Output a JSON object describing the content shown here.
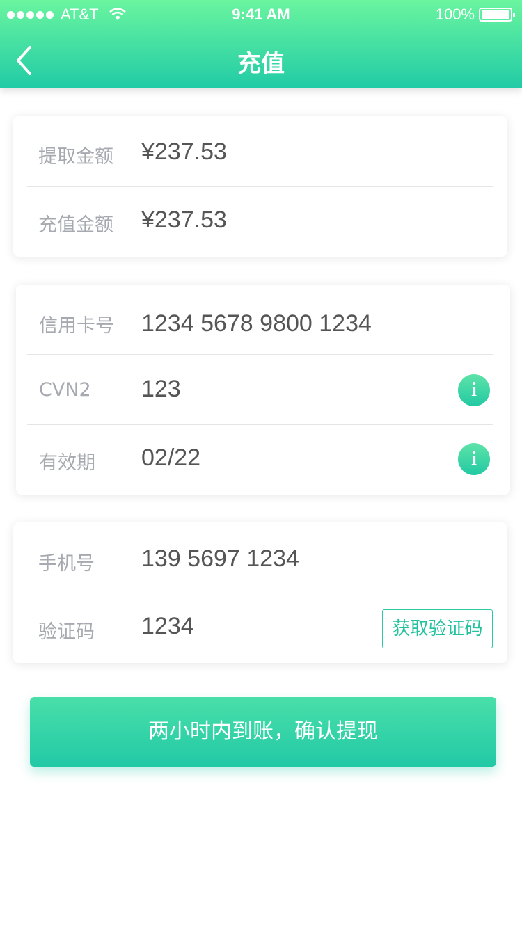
{
  "status_bar": {
    "carrier": "AT&T",
    "time": "9:41 AM",
    "battery": "100%"
  },
  "header": {
    "title": "充值",
    "back_icon": "chevron-left-icon"
  },
  "amount_card": {
    "rows": [
      {
        "label": "提取金额",
        "value": "¥237.53"
      },
      {
        "label": "充值金额",
        "value": "¥237.53"
      }
    ]
  },
  "card_info": {
    "rows": [
      {
        "label": "信用卡号",
        "value": "1234 5678 9800 1234"
      },
      {
        "label": "CVN2",
        "value": "123",
        "icon": "info-icon",
        "icon_glyph": "i"
      },
      {
        "label": "有效期",
        "value": "02/22",
        "icon": "info-icon",
        "icon_glyph": "i"
      }
    ]
  },
  "phone_card": {
    "rows": [
      {
        "label": "手机号",
        "value": "139 5697 1234"
      },
      {
        "label": "验证码",
        "value": "1234"
      }
    ],
    "sms_button": "获取验证码"
  },
  "confirm_button": "两小时内到账，确认提现",
  "colors": {
    "header_top": "#6af59f",
    "header_bottom": "#21cba6",
    "accent": "#22c9a3",
    "label": "#a6aab0",
    "value": "#555555"
  }
}
